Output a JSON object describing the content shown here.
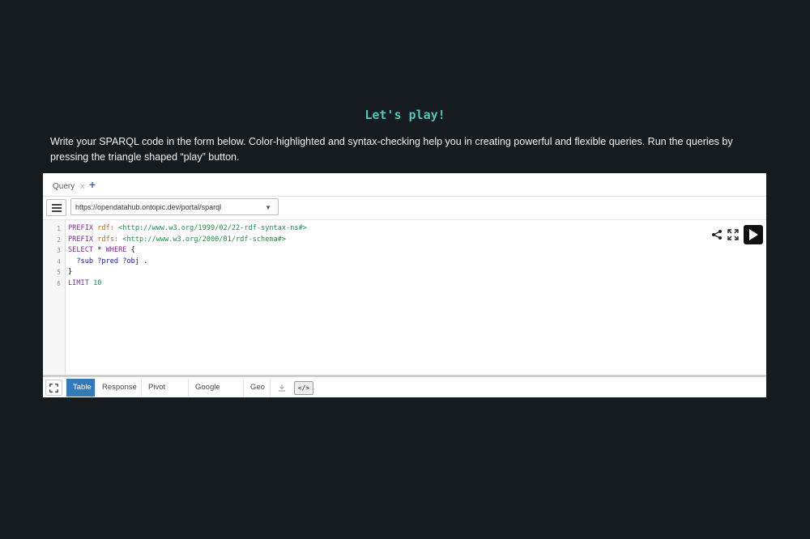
{
  "heading": "Let's play!",
  "intro": "Write your SPARQL code in the form below. Color-highlighted and syntax-checking help you in creating powerful and flexible queries. Run the queries by pressing the triangle shaped “play” button.",
  "tabs": [
    {
      "label": "Query",
      "close": "x"
    }
  ],
  "add_tab": "+",
  "endpoint": {
    "value": "https://opendatahub.ontopic.dev/portal/sparql",
    "caret": "▼"
  },
  "editor": {
    "line_numbers": [
      "1",
      "2",
      "3",
      "4",
      "5",
      "6"
    ],
    "lines": {
      "l1": {
        "kw": "PREFIX",
        "pfx": "rdf:",
        "iri": "<http://www.w3.org/1999/02/22-rdf-syntax-ns#>"
      },
      "l2": {
        "kw": "PREFIX",
        "pfx": "rdfs:",
        "iri": "<http://www.w3.org/2000/01/rdf-schema#>"
      },
      "l3": {
        "select": "SELECT",
        "star": "*",
        "where": "WHERE",
        "brace": "{"
      },
      "l4": {
        "vars": "?sub ?pred ?obj",
        "dot": "."
      },
      "l5": {
        "brace": "}"
      },
      "l6": {
        "kw": "LIMIT",
        "num": "10"
      }
    }
  },
  "result_tabs": [
    "Table",
    "Response",
    "Pivot Table",
    "Google Chart",
    "Geo"
  ],
  "active_result_tab": "Table",
  "code_button": "</>",
  "colors": {
    "background": "#161b1f",
    "heading": "#4fc6b8",
    "active_tab": "#337ab7"
  }
}
